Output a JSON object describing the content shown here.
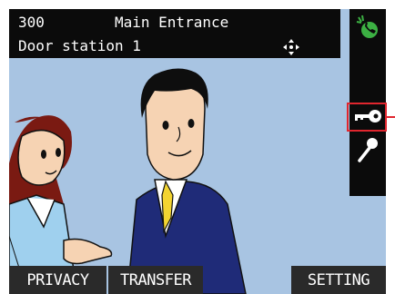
{
  "header": {
    "unit_number": "300",
    "unit_name": "Main Entrance",
    "station_name": "Door station 1",
    "move_icon": "move-arrows-icon"
  },
  "side_buttons": [
    {
      "icon": "call-status-icon"
    },
    {
      "icon": "door-release-key-icon",
      "highlighted": true
    },
    {
      "icon": "microphone-icon"
    }
  ],
  "bottom_buttons": {
    "privacy": "PRIVACY",
    "transfer": "TRANSFER",
    "setting": "SETTING"
  },
  "colors": {
    "background": "#a8c4e2",
    "bar": "#0b0b0b",
    "button": "#2a2a2a",
    "highlight": "#e0262e",
    "status_green": "#3cb043"
  }
}
